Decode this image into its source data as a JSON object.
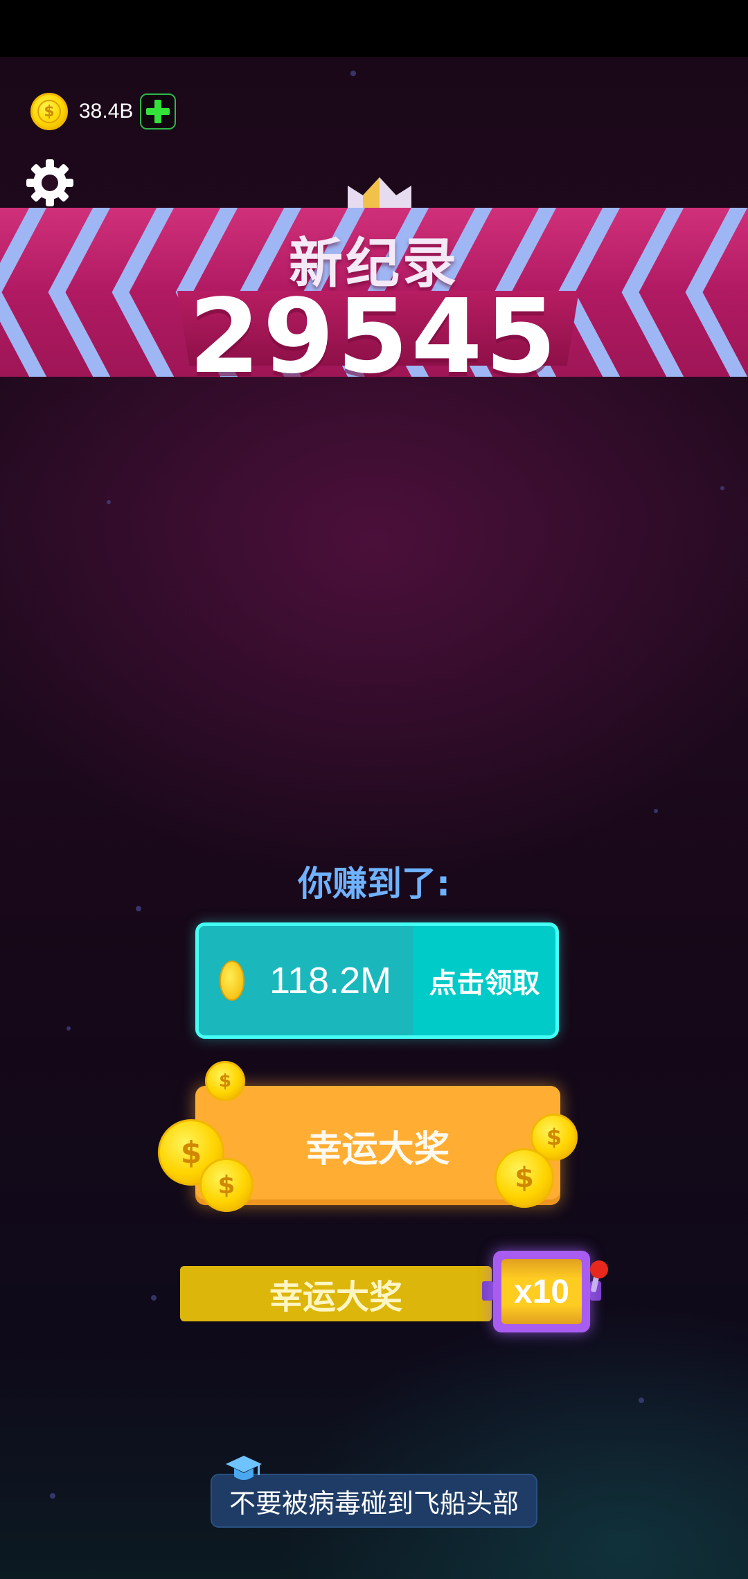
{
  "hud": {
    "currency_amount": "38.4B",
    "coin_symbol": "$"
  },
  "result": {
    "banner_title": "新纪录",
    "score": "29545"
  },
  "reward": {
    "earned_label": "你赚到了:",
    "amount": "118.2M",
    "claim_label": "点击领取"
  },
  "buttons": {
    "jackpot_label": "幸运大奖",
    "jackpot_bar_label": "幸运大奖",
    "slot_multiplier": "x10"
  },
  "tip": {
    "text": "不要被病毒碰到飞船头部"
  },
  "colors": {
    "banner_pink": "#c0256e",
    "chevron_blue": "#8fa8f0",
    "cyan_panel": "#00cbc8",
    "orange_button": "#ffad33",
    "yellow_bar": "#dcb60a",
    "slot_purple": "#a85df0",
    "earned_label_blue": "#6fb2ff"
  }
}
